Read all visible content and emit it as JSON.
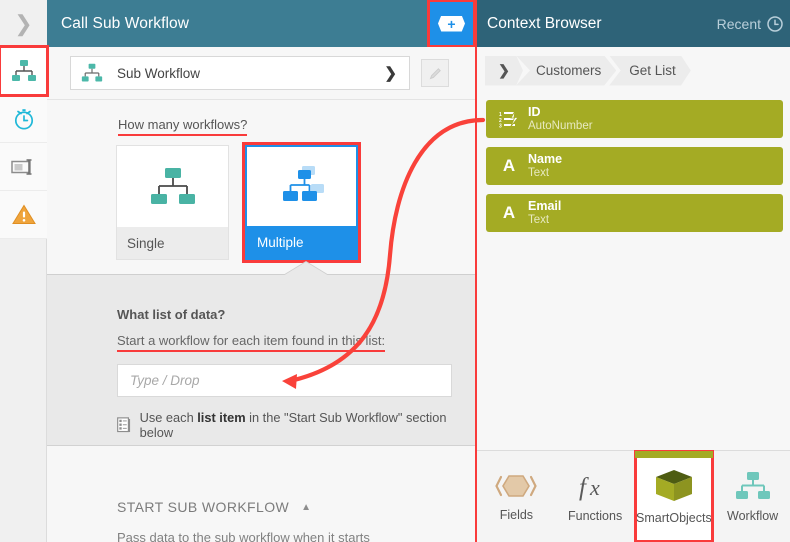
{
  "colors": {
    "header_teal": "#3d7d93",
    "ctx_header_teal": "#2e6378",
    "accent_blue": "#1e90e8",
    "annotation_red": "#f93b3b",
    "field_olive": "#a4ab24",
    "icon_teal": "#4cb8a9"
  },
  "rail": {
    "collapse_icon": "chevron-right-icon",
    "items": [
      {
        "icon": "workflow-hierarchy-icon",
        "name": "sidebar-item-workflow",
        "selected": true
      },
      {
        "icon": "timer-clock-icon",
        "name": "sidebar-item-timer",
        "selected": false
      },
      {
        "icon": "form-input-icon",
        "name": "sidebar-item-form",
        "selected": false
      },
      {
        "icon": "warning-triangle-icon",
        "name": "sidebar-item-warning",
        "selected": false
      }
    ]
  },
  "main": {
    "title": "Call Sub Workflow",
    "add_button_icon": "plus-hexagon-icon",
    "dropdown": {
      "icon": "workflow-hierarchy-icon",
      "value": "Sub Workflow",
      "chevron": "chevron-down-icon"
    },
    "edit_button_icon": "pencil-icon",
    "question": {
      "label": "How many workflows?",
      "options": [
        {
          "caption": "Single",
          "icon": "single-workflow-icon",
          "selected": false
        },
        {
          "caption": "Multiple",
          "icon": "multiple-workflow-icon",
          "selected": true
        }
      ]
    },
    "list_section": {
      "title": "What list of data?",
      "subtitle": "Start a workflow for each item found in this list:",
      "input_value": "",
      "input_placeholder": "Type / Drop",
      "note_icon": "list-table-icon",
      "note_prefix": "Use each ",
      "note_bold": "list item",
      "note_suffix": " in the \"Start Sub Workflow\" section below"
    },
    "start_section": {
      "title": "START SUB WORKFLOW",
      "caret": "caret-up-icon",
      "subtitle": "Pass data to the sub workflow when it starts"
    }
  },
  "context_browser": {
    "title": "Context Browser",
    "recent_label": "Recent",
    "recent_icon": "clock-icon",
    "breadcrumb": {
      "chevron": "chevron-down-icon",
      "crumbs": [
        "Customers",
        "Get List"
      ]
    },
    "fields": [
      {
        "name": "ID",
        "type": "AutoNumber",
        "icon": "autonumber-list-icon"
      },
      {
        "name": "Name",
        "type": "Text",
        "icon": "text-a-icon"
      },
      {
        "name": "Email",
        "type": "Text",
        "icon": "text-a-icon"
      }
    ],
    "tabs": [
      {
        "label": "Fields",
        "icon": "fields-hexagon-icon",
        "active": false
      },
      {
        "label": "Functions",
        "icon": "fx-icon",
        "active": false
      },
      {
        "label": "SmartObjects",
        "icon": "cube-icon",
        "active": true
      },
      {
        "label": "Workflow",
        "icon": "workflow-hierarchy-icon",
        "active": false
      }
    ]
  },
  "annotations": {
    "arrow": "curved-red-arrow-from-id-field-to-type-drop-input"
  }
}
